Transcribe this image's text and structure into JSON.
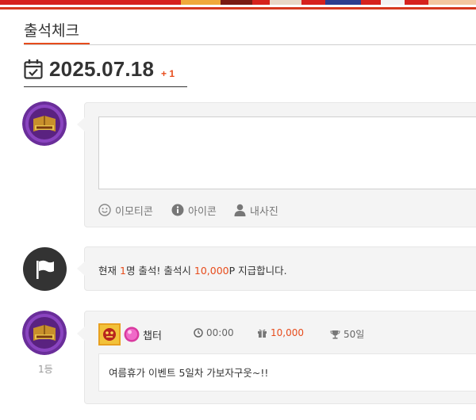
{
  "page": {
    "title": "출석체크"
  },
  "date_bar": {
    "date": "2025.07.18",
    "delta": "+ 1"
  },
  "compose": {
    "tools": [
      {
        "icon": "smiley-icon",
        "label": "이모티콘"
      },
      {
        "icon": "info-icon",
        "label": "아이콘"
      },
      {
        "icon": "user-icon",
        "label": "내사진"
      }
    ]
  },
  "notice": {
    "prefix": "현재 ",
    "count": "1",
    "middle": "명 출석! 출석시 ",
    "points": "10,000",
    "suffix": "P 지급합니다."
  },
  "entry": {
    "nickname": "챕터",
    "time": "00:00",
    "points": "10,000",
    "days": "50일",
    "rank": "1등",
    "comment": "여름휴가 이벤트 5일차 가보자구웃~!!"
  },
  "colors": {
    "accent": "#e74c1c",
    "banner_red": "#d6211d",
    "flag_circle": "#333333",
    "bubble_bg": "#f4f4f4"
  }
}
